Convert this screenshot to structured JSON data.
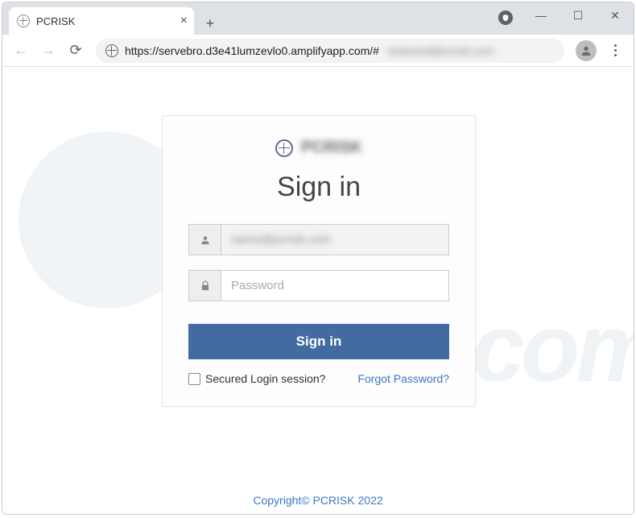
{
  "window": {
    "tab_title": "PCRISK"
  },
  "addressbar": {
    "url_visible": "https://servebro.d3e41lumzevlo0.amplifyapp.com/#",
    "url_blurred": "redacted@email.com"
  },
  "watermark": {
    "text": "risk.com"
  },
  "login": {
    "brand_blurred": "PCRISK",
    "heading": "Sign in",
    "email_value_blurred": "name@pcrisk.com",
    "password_placeholder": "Password",
    "submit_label": "Sign in",
    "secured_label": "Secured Login session?",
    "secured_checked": false,
    "forgot_label": "Forgot Password?"
  },
  "footer": {
    "copyright": "Copyright© PCRISK 2022"
  }
}
